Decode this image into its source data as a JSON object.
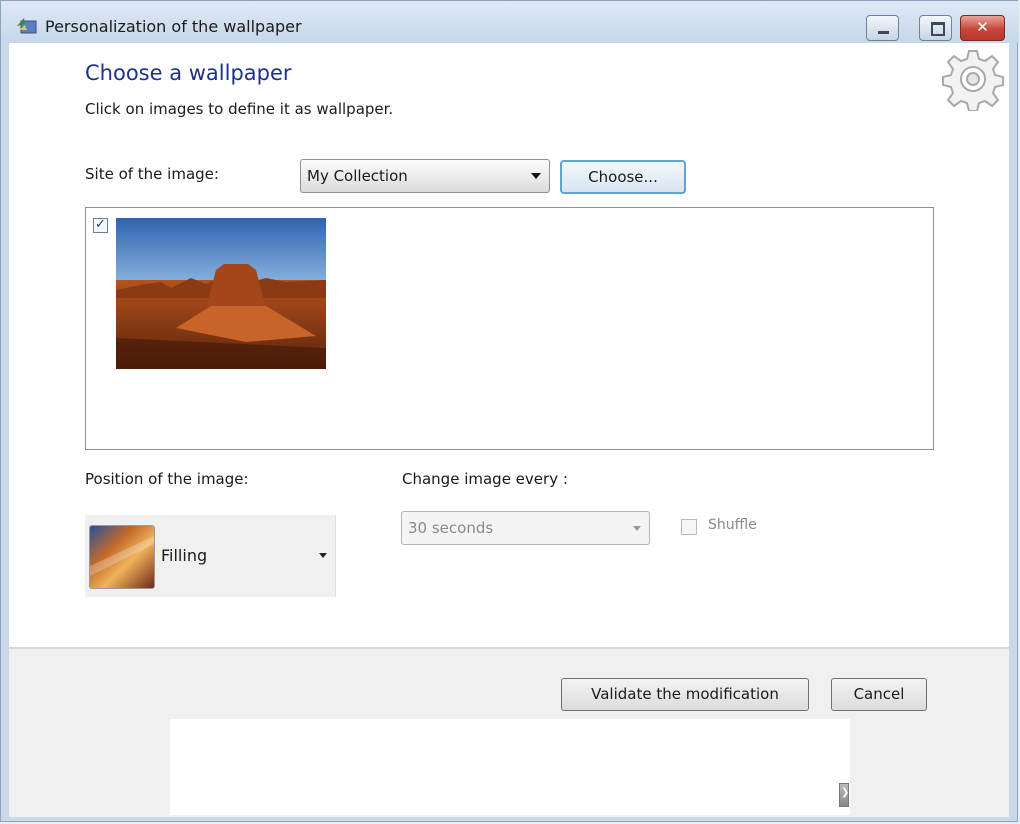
{
  "window": {
    "title": "Personalization of the wallpaper",
    "controls": {
      "minimize": "minimize-icon",
      "maximize": "maximize-icon",
      "close": "close-icon",
      "close_glyph": "✕"
    }
  },
  "header": {
    "title": "Choose a wallpaper",
    "subtitle": "Click on images to define it as wallpaper."
  },
  "site": {
    "label": "Site of the image:",
    "selected": "My Collection",
    "choose_button": "Choose..."
  },
  "images": [
    {
      "checked": true,
      "check_glyph": "✓",
      "description_icon": "desert-wallpaper-thumbnail"
    }
  ],
  "position": {
    "label": "Position of the image:",
    "selected": "Filling"
  },
  "interval": {
    "label": "Change image every :",
    "selected": "30 seconds",
    "enabled": false
  },
  "shuffle": {
    "label": "Shuffle",
    "checked": false,
    "enabled": false
  },
  "footer": {
    "validate_button": "Validate the modification",
    "cancel_button": "Cancel",
    "ad_arrow_glyph": "❯"
  },
  "colors": {
    "heading": "#1e3287",
    "titlebar": "#c6d7ea",
    "close_button": "#c7473a",
    "focus_border": "#5ea4d6"
  }
}
